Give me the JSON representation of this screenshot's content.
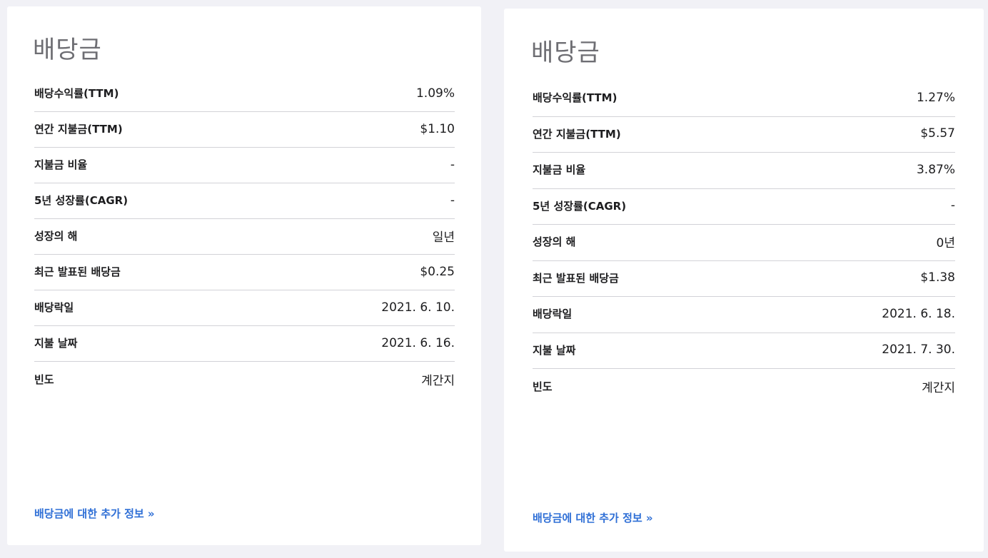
{
  "left_card": {
    "title": "배당금",
    "rows": [
      {
        "label": "배당수익률(TTM)",
        "value": "1.09%"
      },
      {
        "label": "연간 지불금(TTM)",
        "value": "$1.10"
      },
      {
        "label": "지불금 비율",
        "value": "-"
      },
      {
        "label": "5년 성장률(CAGR)",
        "value": "-"
      },
      {
        "label": "성장의 해",
        "value": "일년"
      },
      {
        "label": "최근 발표된 배당금",
        "value": "$0.25"
      },
      {
        "label": "배당락일",
        "value": "2021. 6. 10."
      },
      {
        "label": "지불 날짜",
        "value": "2021. 6. 16."
      },
      {
        "label": "빈도",
        "value": "계간지"
      }
    ],
    "more_link": "배당금에 대한 추가 정보 »"
  },
  "right_card": {
    "title": "배당금",
    "rows": [
      {
        "label": "배당수익률(TTM)",
        "value": "1.27%"
      },
      {
        "label": "연간 지불금(TTM)",
        "value": "$5.57"
      },
      {
        "label": "지불금 비율",
        "value": "3.87%"
      },
      {
        "label": "5년 성장률(CAGR)",
        "value": "-"
      },
      {
        "label": "성장의 해",
        "value": "0년"
      },
      {
        "label": "최근 발표된 배당금",
        "value": "$1.38"
      },
      {
        "label": "배당락일",
        "value": "2021. 6. 18."
      },
      {
        "label": "지불 날짜",
        "value": "2021. 7. 30."
      },
      {
        "label": "빈도",
        "value": "계간지"
      }
    ],
    "more_link": "배당금에 대한 추가 정보 »"
  },
  "colors": {
    "background": "#f1f1f6",
    "card": "#ffffff",
    "title": "#6e6e73",
    "text": "#1d1d1f",
    "divider": "#d2d2d7",
    "link": "#2f6fd6"
  }
}
